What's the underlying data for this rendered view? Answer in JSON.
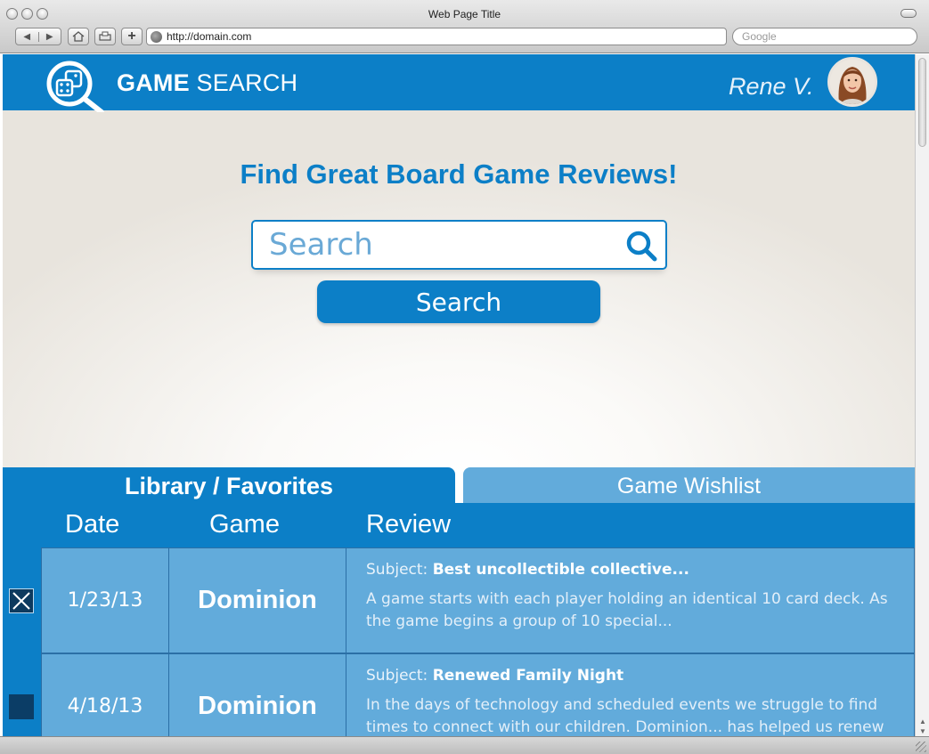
{
  "browser": {
    "window_title": "Web Page Title",
    "url": "http://domain.com",
    "search_placeholder": "Google"
  },
  "app": {
    "brand_bold": "GAME",
    "brand_light": " SEARCH",
    "user_name": "Rene V."
  },
  "hero": {
    "title": "Find Great Board Game Reviews!",
    "search_placeholder": "Search",
    "search_button": "Search"
  },
  "tabs": [
    {
      "label": "Library / Favorites",
      "active": true
    },
    {
      "label": "Game Wishlist",
      "active": false
    }
  ],
  "table": {
    "columns": [
      "Date",
      "Game",
      "Review"
    ],
    "subject_prefix": "Subject: ",
    "rows": [
      {
        "selected": true,
        "date": "1/23/13",
        "game": "Dominion",
        "subject": "Best uncollectible collective...",
        "review": "A game starts with each player holding an identical 10 card deck. As the game begins a group of 10 special..."
      },
      {
        "selected": false,
        "date": "4/18/13",
        "game": "Dominion",
        "subject": "Renewed Family Night",
        "review": "In the days of technology and scheduled events we struggle to find times to connect with our children. Dominion... has helped us renew"
      }
    ]
  },
  "colors": {
    "primary": "#0c7fc7",
    "row_bg": "#62abdb",
    "selector_dark": "#0b3d66"
  }
}
